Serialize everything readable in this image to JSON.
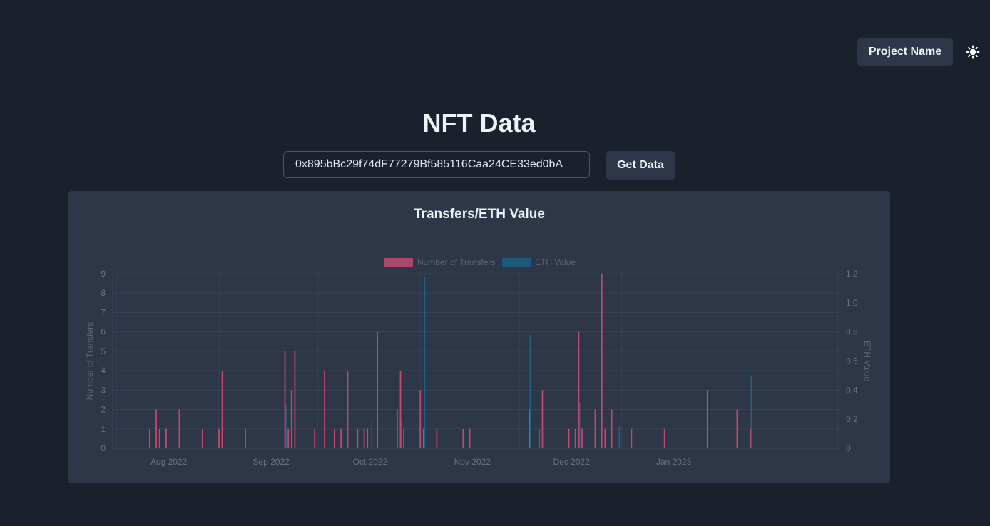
{
  "header": {
    "project_button": "Project Name",
    "theme_icon": "sun-icon"
  },
  "main": {
    "title": "NFT Data",
    "address_input_value": "0x895bBc29f74dF77279Bf585116Caa24CE33ed0bA",
    "get_button": "Get Data"
  },
  "colors": {
    "background": "#1a202c",
    "card": "#2d3748",
    "transfers": "#c8466f",
    "eth": "#1e5a7a"
  },
  "chart_data": {
    "type": "bar",
    "title": "Transfers/ETH Value",
    "legend": [
      "Number of Transfers",
      "ETH Value"
    ],
    "legend_position": "top",
    "y_left": {
      "label": "Number of Transfers",
      "ticks": [
        "0",
        "1",
        "2",
        "3",
        "4",
        "5",
        "6",
        "7",
        "8",
        "9"
      ],
      "ylim": [
        0,
        9
      ]
    },
    "y_right": {
      "label": "ETH Value",
      "ticks": [
        "0",
        "0.2",
        "0.4",
        "0.6",
        "0.8",
        "1.0",
        "1.2"
      ],
      "ylim": [
        0,
        1.2
      ]
    },
    "x_axis": {
      "type": "time",
      "range": [
        "2022-07-15",
        "2023-02-20"
      ],
      "ticks": [
        {
          "date": "2022-08-01",
          "label": "Aug 2022"
        },
        {
          "date": "2022-09-01",
          "label": "Sep 2022"
        },
        {
          "date": "2022-10-01",
          "label": "Oct 2022"
        },
        {
          "date": "2022-11-01",
          "label": "Nov 2022"
        },
        {
          "date": "2022-12-01",
          "label": "Dec 2022"
        },
        {
          "date": "2023-01-01",
          "label": "Jan 2023"
        }
      ]
    },
    "grid": true,
    "series": [
      {
        "name": "Number of Transfers",
        "axis": "left",
        "points": [
          [
            "2022-07-26",
            1
          ],
          [
            "2022-07-28",
            2
          ],
          [
            "2022-07-29",
            1
          ],
          [
            "2022-07-31",
            1
          ],
          [
            "2022-08-04",
            2
          ],
          [
            "2022-08-11",
            1
          ],
          [
            "2022-08-16",
            1
          ],
          [
            "2022-08-17",
            4
          ],
          [
            "2022-08-24",
            1
          ],
          [
            "2022-09-05",
            5
          ],
          [
            "2022-09-06",
            1
          ],
          [
            "2022-09-07",
            3
          ],
          [
            "2022-09-08",
            5
          ],
          [
            "2022-09-14",
            1
          ],
          [
            "2022-09-17",
            4
          ],
          [
            "2022-09-20",
            1
          ],
          [
            "2022-09-22",
            1
          ],
          [
            "2022-09-24",
            4
          ],
          [
            "2022-09-27",
            1
          ],
          [
            "2022-09-29",
            1
          ],
          [
            "2022-09-30",
            1
          ],
          [
            "2022-10-03",
            6
          ],
          [
            "2022-10-09",
            2
          ],
          [
            "2022-10-10",
            4
          ],
          [
            "2022-10-11",
            1
          ],
          [
            "2022-10-16",
            3
          ],
          [
            "2022-10-17",
            1
          ],
          [
            "2022-10-21",
            1
          ],
          [
            "2022-10-29",
            1
          ],
          [
            "2022-10-31",
            1
          ],
          [
            "2022-11-18",
            2
          ],
          [
            "2022-11-21",
            1
          ],
          [
            "2022-11-22",
            3
          ],
          [
            "2022-11-30",
            1
          ],
          [
            "2022-12-02",
            1
          ],
          [
            "2022-12-03",
            6
          ],
          [
            "2022-12-04",
            1
          ],
          [
            "2022-12-08",
            2
          ],
          [
            "2022-12-10",
            9
          ],
          [
            "2022-12-11",
            1
          ],
          [
            "2022-12-13",
            2
          ],
          [
            "2022-12-19",
            1
          ],
          [
            "2022-12-29",
            1
          ],
          [
            "2023-01-11",
            3
          ],
          [
            "2023-01-20",
            2
          ],
          [
            "2023-01-24",
            1
          ]
        ]
      },
      {
        "name": "ETH Value",
        "axis": "right",
        "points": [
          [
            "2022-09-05",
            0.3
          ],
          [
            "2022-10-01",
            0.18
          ],
          [
            "2022-10-10",
            0.2
          ],
          [
            "2022-10-17",
            1.18
          ],
          [
            "2022-11-18",
            0.78
          ],
          [
            "2022-12-03",
            0.31
          ],
          [
            "2022-12-15",
            0.15
          ],
          [
            "2023-01-24",
            0.5
          ]
        ]
      }
    ]
  }
}
